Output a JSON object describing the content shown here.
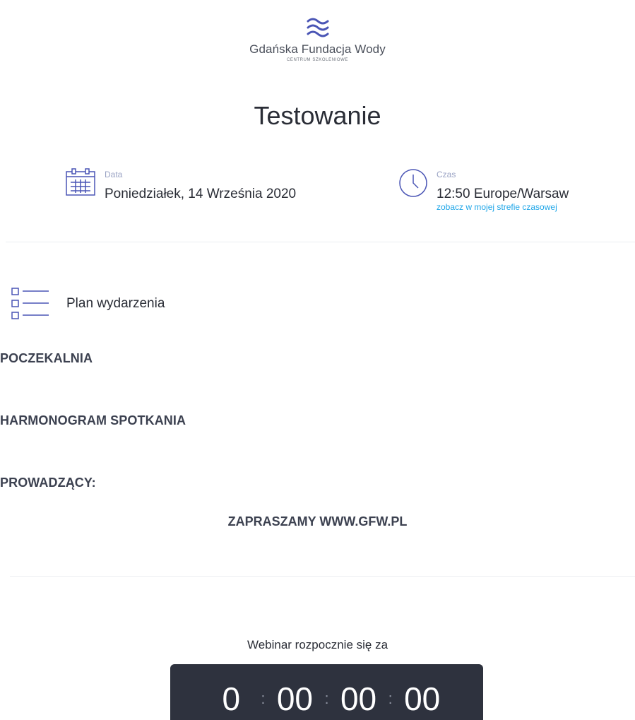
{
  "logo": {
    "name": "Gdańska Fundacja Wody",
    "subtitle": "CENTRUM SZKOLENIOWE"
  },
  "title": "Testowanie",
  "date": {
    "label": "Data",
    "value": "Poniedziałek, 14 Września 2020"
  },
  "time": {
    "label": "Czas",
    "value": "12:50 Europe/Warsaw",
    "link": "zobacz w mojej strefie czasowej"
  },
  "plan": {
    "label": "Plan wydarzenia",
    "items": [
      "POCZEKALNIA",
      "HARMONOGRAM SPOTKANIA",
      "PROWADZĄCY:"
    ],
    "footer": "ZAPRASZAMY WWW.GFW.PL"
  },
  "countdown": {
    "label": "Webinar rozpocznie się za",
    "days": "0",
    "hours": "00",
    "minutes": "00",
    "seconds": "00",
    "separator": ":"
  },
  "colors": {
    "accent": "#1fa6e8",
    "icon": "#4a55b5",
    "countdown_bg": "#2e323e"
  }
}
